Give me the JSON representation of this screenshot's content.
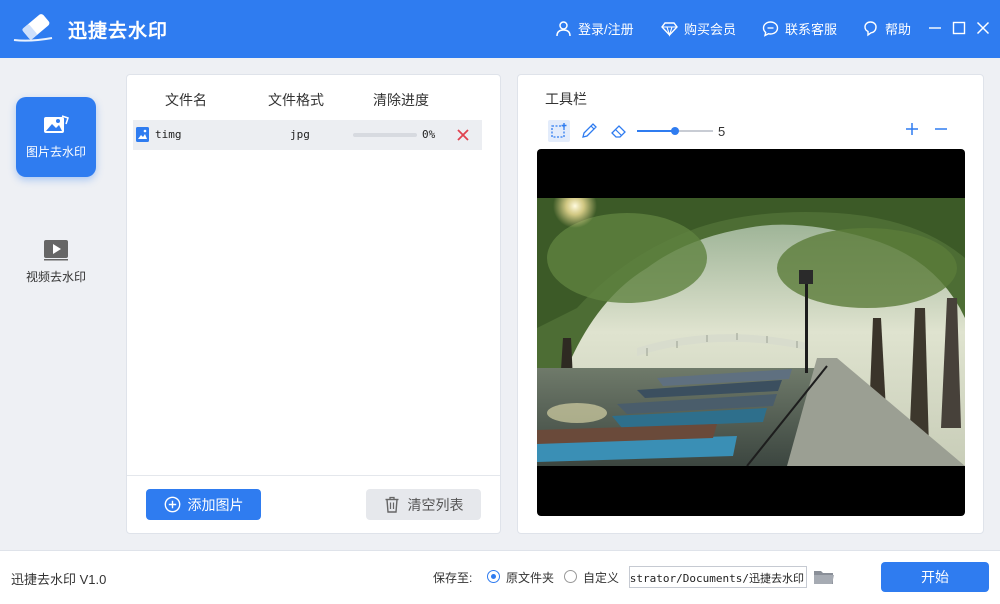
{
  "app": {
    "title": "迅捷去水印",
    "version_text": "迅捷去水印 V1.0"
  },
  "header_menu": {
    "login": "登录/注册",
    "buy_vip": "购买会员",
    "contact": "联系客服",
    "help": "帮助"
  },
  "sidebar": {
    "items": [
      {
        "label": "图片去水印",
        "icon": "image-icon",
        "active": true
      },
      {
        "label": "视频去水印",
        "icon": "video-icon",
        "active": false
      }
    ]
  },
  "file_list": {
    "columns": [
      "文件名",
      "文件格式",
      "清除进度"
    ],
    "rows": [
      {
        "name": "timg",
        "format": "jpg",
        "progress": 0,
        "progress_text": "0%"
      }
    ],
    "add_button": "添加图片",
    "clear_button": "清空列表"
  },
  "toolbar": {
    "title": "工具栏",
    "tools": [
      "rectangle-select-icon",
      "pen-icon",
      "eraser-icon"
    ],
    "brush_size": 5,
    "brush_max": 10
  },
  "bottom": {
    "save_label": "保存至:",
    "options": [
      "原文件夹",
      "自定义"
    ],
    "selected_option": 0,
    "path_value": "C:/Users/Administrator/Documents/迅捷去水印",
    "start_button": "开始"
  },
  "colors": {
    "primary": "#2f7cf0",
    "delete": "#e0424f",
    "background": "#eef0f4"
  }
}
